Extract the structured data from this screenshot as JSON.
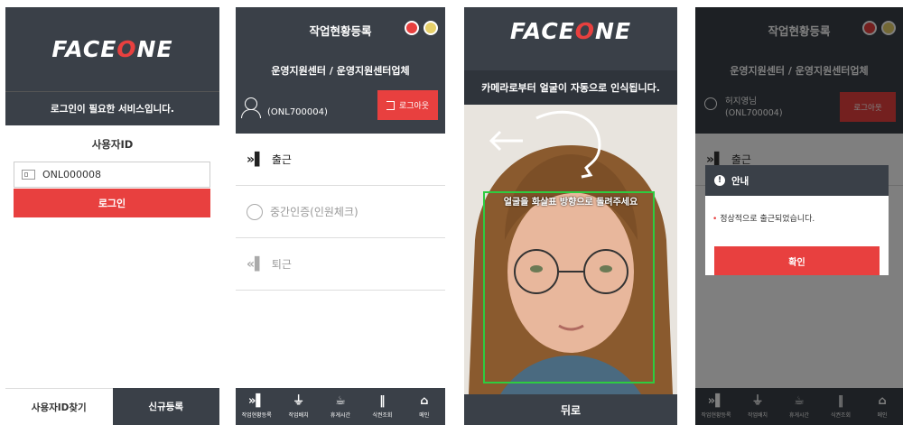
{
  "login": {
    "logo_pre": "FACE",
    "logo_o": "O",
    "logo_post": "NE",
    "notice": "로그인이 필요한 서비스입니다.",
    "userid_label": "사용자ID",
    "userid_value": "ONL000008",
    "login_button": "로그인",
    "find_id": "사용자ID찾기",
    "register": "신규등록"
  },
  "main": {
    "title": "작업현황등록",
    "org": "운영지원센터 / 운영지원센터업체",
    "user_id": "(ONL700004)",
    "logout": "로그아웃",
    "menu": [
      {
        "label": "출근",
        "icon": "door-in-icon"
      },
      {
        "label": "중간인증(인원체크)",
        "icon": "timer-icon"
      },
      {
        "label": "퇴근",
        "icon": "door-out-icon"
      }
    ],
    "tabs": [
      {
        "label": "작업현황등록",
        "icon": "door-icon"
      },
      {
        "label": "작업배치",
        "icon": "person-icon"
      },
      {
        "label": "휴게시간",
        "icon": "coffee-icon"
      },
      {
        "label": "식권조회",
        "icon": "utensils-icon"
      },
      {
        "label": "메인",
        "icon": "home-icon"
      }
    ]
  },
  "face": {
    "logo_pre": "FACE",
    "logo_o": "O",
    "logo_post": "NE",
    "instruction": "카메라로부터 얼굴이 자동으로 인식됩니다.",
    "overlay": "얼굴을 화살표 방향으로 돌려주세요",
    "back": "뒤로"
  },
  "dialog_screen": {
    "title": "작업현황등록",
    "org": "운영지원센터 / 운영지원센터업체",
    "user_name": "허지영님",
    "user_id": "(ONL700004)",
    "logout": "로그아웃",
    "bg_menu": "출근",
    "dialog_title": "안내",
    "dialog_msg": "정상적으로 출근되었습니다.",
    "confirm": "확인",
    "tabs": [
      "작업현황등록",
      "작업배치",
      "휴게시간",
      "식권조회",
      "메인"
    ]
  },
  "colors": {
    "dark": "#3a4048",
    "accent": "#e8403f",
    "face_frame": "#2ecc40"
  }
}
